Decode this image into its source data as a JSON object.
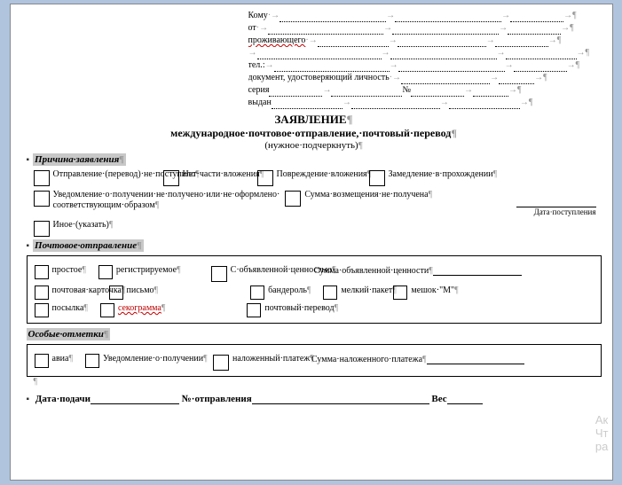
{
  "header": {
    "to": "Кому",
    "from": "от",
    "residing": "проживающего",
    "phone": "тел.",
    "doc": "документ, удостоверяющий личность",
    "series": "серия",
    "number": "№",
    "issued": "выдан"
  },
  "title": "ЗАЯВЛЕНИЕ",
  "subtitle": "международное·почтовое·отправление,·почтовый·перевод",
  "note": "(нужное·подчеркнуть)",
  "reason": {
    "head": "Причина·заявления",
    "opt1": "Отправление·(перевод)·не·поступило",
    "opt2": "Нет·части·вложения",
    "opt3": "Повреждение·вложения",
    "opt4": "Замедление·в·прохождении",
    "opt5a": "Уведомление·о·получении·не·получено·или·не·оформлено·",
    "opt5b": "соответствующим·образом",
    "opt6": "Сумма·возмещения·не·получена",
    "opt7": "Иное·(указать)",
    "date_label": "Дата·поступления"
  },
  "postal": {
    "head": "Почтовое·отправление",
    "simple": "простое",
    "registered": "регистрируемое",
    "declared": "С·объявленной·ценностью",
    "declared_sum": "Сумма·объявленной·ценности",
    "card": "почтовая·карточка",
    "letter": "письмо",
    "parcel_small": "бандероль",
    "small_packet": "мелкий·пакет",
    "bag_m": "мешок·\"М\"",
    "parcel": "посылка",
    "seko": "секограмма",
    "money_order": "почтовый·перевод"
  },
  "marks": {
    "head": "Особые·отметки",
    "avia": "авиа",
    "notice": "Уведомление·о·получении",
    "cod": "наложенный·платеж",
    "cod_sum": "Сумма·наложенного·платежа"
  },
  "footer": {
    "date": "Дата·подачи",
    "number": "№·отправления",
    "weight": "Вес"
  },
  "watermark": {
    "l1": "Ак",
    "l2": "Чт",
    "l3": "ра"
  }
}
